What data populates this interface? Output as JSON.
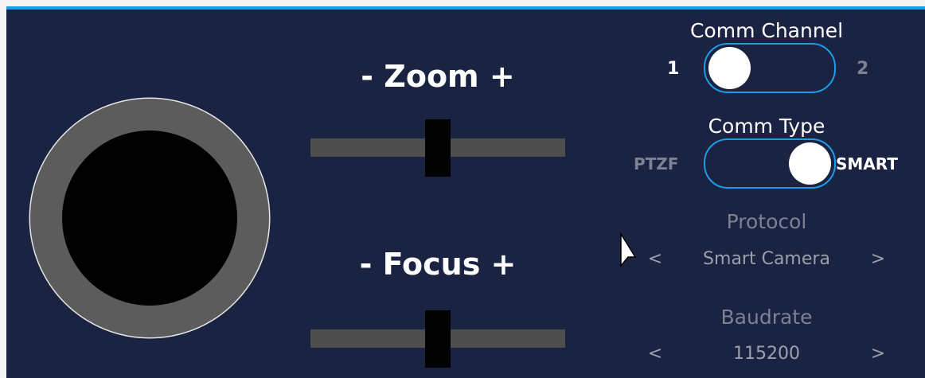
{
  "sliders": {
    "zoom": {
      "label": "- Zoom +",
      "level": 0.5
    },
    "focus": {
      "label": "- Focus +",
      "level": 0.5
    }
  },
  "comm_channel": {
    "title": "Comm Channel",
    "left_option": "1",
    "right_option": "2",
    "selected": "1"
  },
  "comm_type": {
    "title": "Comm Type",
    "left_option": "PTZF",
    "right_option": "SMART",
    "selected": "SMART"
  },
  "protocol": {
    "title": "Protocol",
    "prev": "<",
    "value": "Smart Camera",
    "next": ">"
  },
  "baudrate": {
    "title": "Baudrate",
    "prev": "<",
    "value": "115200",
    "next": ">"
  },
  "colors": {
    "panel_bg": "#1a2342",
    "accent": "#1e9be8",
    "track": "#4e4e4e",
    "dim_text": "#7b8293"
  },
  "icons": {
    "cursor": "mouse-pointer-icon"
  }
}
